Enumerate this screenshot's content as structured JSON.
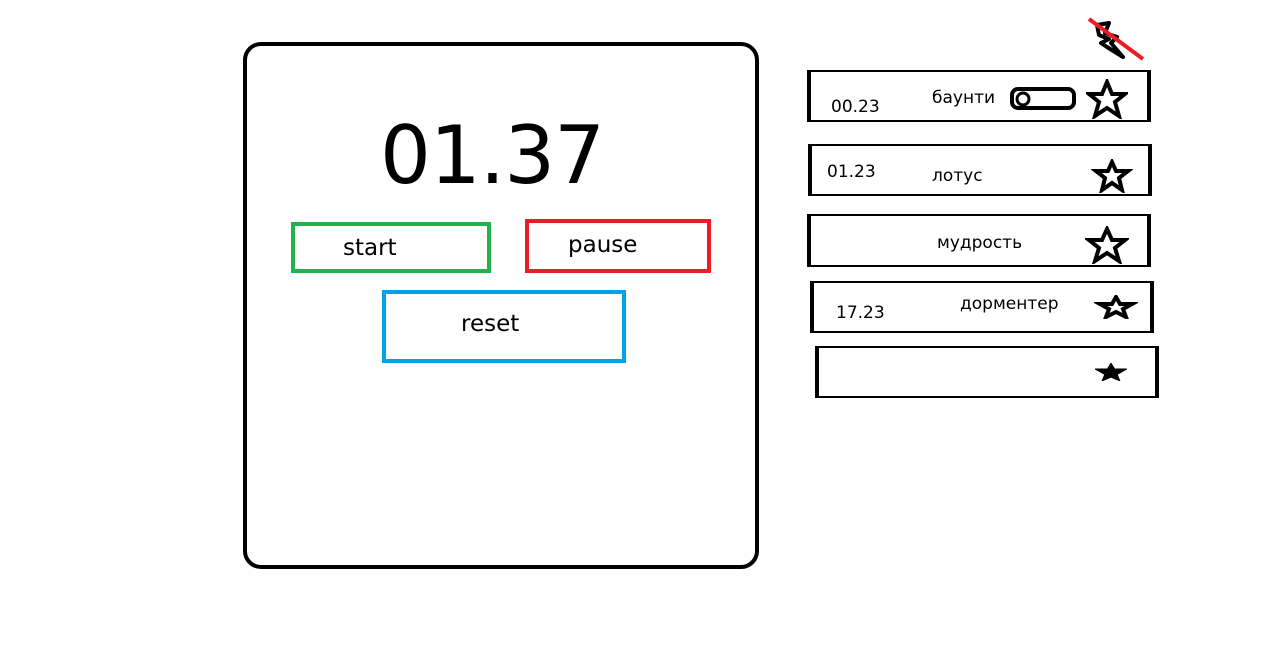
{
  "timer": {
    "time": "01.37",
    "start_label": "start",
    "pause_label": "pause",
    "reset_label": "reset"
  },
  "header": {
    "crossed_icon": "crossed-out-lightning-icon"
  },
  "list": {
    "items": [
      {
        "time": "00.23",
        "name": "баунти",
        "favorite_icon": "star-icon",
        "toggle": "toggle-switch"
      },
      {
        "time": "01.23",
        "name": "лотус",
        "favorite_icon": "star-icon"
      },
      {
        "time": "",
        "name": "мудрость",
        "favorite_icon": "star-icon"
      },
      {
        "time": "17.23",
        "name": "дорментер",
        "favorite_icon": "star-icon"
      },
      {
        "time": "",
        "name": "",
        "favorite_icon": "star-icon"
      }
    ]
  },
  "colors": {
    "start": "#22b14c",
    "pause": "#ed1c24",
    "reset": "#00a2e8",
    "strike": "#ed1c24"
  }
}
